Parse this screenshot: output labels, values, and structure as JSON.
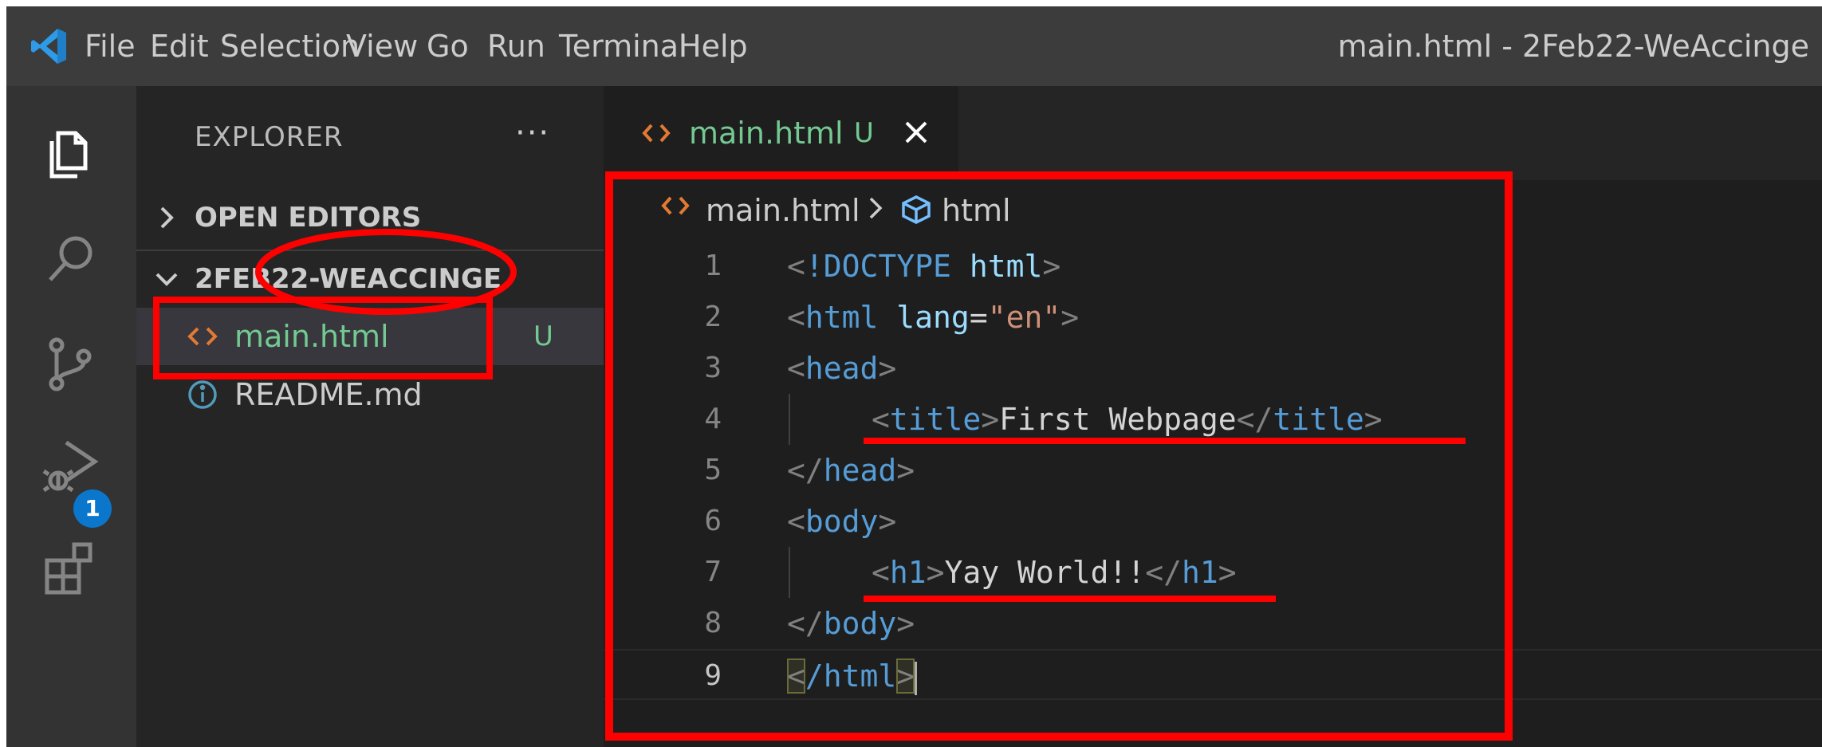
{
  "window": {
    "title": "main.html - 2Feb22-WeAccinge",
    "menu": [
      "File",
      "Edit",
      "Selection",
      "View",
      "Go",
      "Run",
      "Terminal",
      "Help"
    ]
  },
  "activity_bar": {
    "items": [
      {
        "name": "explorer",
        "icon": "files-icon"
      },
      {
        "name": "search",
        "icon": "search-icon"
      },
      {
        "name": "source-control",
        "icon": "source-control-icon",
        "badge": "1"
      },
      {
        "name": "run-and-debug",
        "icon": "run-debug-icon"
      },
      {
        "name": "extensions",
        "icon": "extensions-icon"
      }
    ]
  },
  "sidebar": {
    "title": "EXPLORER",
    "more_actions": "···",
    "sections": {
      "open_editors": "OPEN EDITORS",
      "folder": "2FEB22-WEACCINGE"
    },
    "files": [
      {
        "name": "main.html",
        "status": "U",
        "icon": "html-file-icon",
        "selected": true,
        "color": "#73c991"
      },
      {
        "name": "README.md",
        "status": "",
        "icon": "info-icon",
        "selected": false,
        "color": "#cccccc"
      }
    ]
  },
  "editor": {
    "tab": {
      "name": "main.html",
      "status": "U"
    },
    "breadcrumb": {
      "file": "main.html",
      "symbol": "html"
    },
    "lines": [
      "1",
      "2",
      "3",
      "4",
      "5",
      "6",
      "7",
      "8",
      "9"
    ],
    "code": {
      "l1": [
        "<",
        "!DOCTYPE",
        " ",
        "html",
        ">"
      ],
      "l2": [
        "<",
        "html",
        " ",
        "lang",
        "=",
        "\"en\"",
        ">"
      ],
      "l3": [
        "<",
        "head",
        ">"
      ],
      "l4": [
        "<",
        "title",
        ">",
        "First Webpage",
        "</",
        "title",
        ">"
      ],
      "l5": [
        "</",
        "head",
        ">"
      ],
      "l6": [
        "<",
        "body",
        ">"
      ],
      "l7": [
        "<",
        "h1",
        ">",
        "Yay World!!",
        "</",
        "h1",
        ">"
      ],
      "l8": [
        "</",
        "body",
        ">"
      ],
      "l9": [
        "<",
        "/html",
        ">"
      ]
    }
  },
  "colors": {
    "annotation_red": "#ff0000",
    "tag_blue": "#569cd6",
    "string_orange": "#ce9178",
    "untracked_green": "#73c991"
  }
}
